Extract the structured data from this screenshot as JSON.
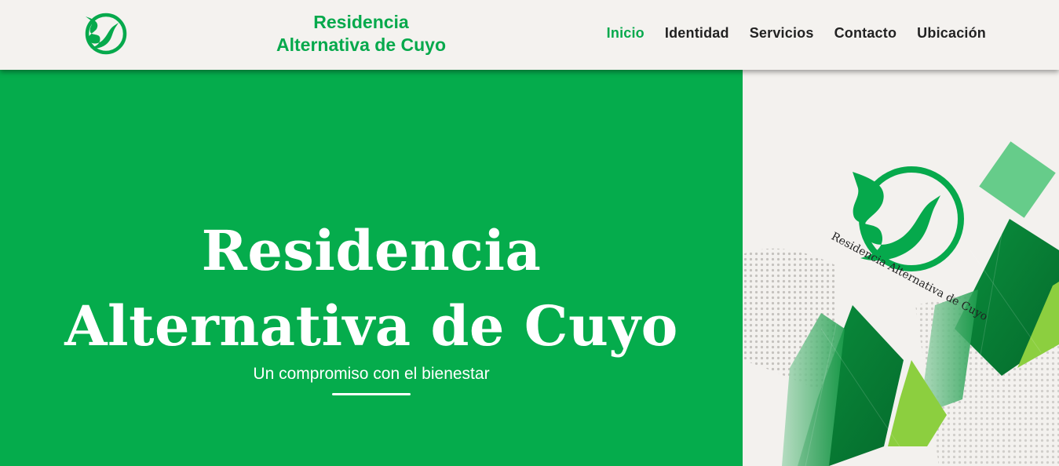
{
  "header": {
    "brand_line1": "Residencia",
    "brand_line2": "Alternativa de Cuyo",
    "logo_icon": "bird-circle-logo-icon"
  },
  "nav": {
    "items": [
      {
        "label": "Inicio",
        "active": true
      },
      {
        "label": "Identidad",
        "active": false
      },
      {
        "label": "Servicios",
        "active": false
      },
      {
        "label": "Contacto",
        "active": false
      },
      {
        "label": "Ubicación",
        "active": false
      }
    ]
  },
  "hero": {
    "title_line1": "Residencia",
    "title_line2": "Alternativa de Cuyo",
    "subtitle": "Un compromiso con el bienestar"
  },
  "art": {
    "emblem_text": "Residencia Alternativa de Cuyo"
  },
  "colors": {
    "brand_green": "#06a94c",
    "hero_green": "#05ac4c",
    "light_green": "#8ccf3f",
    "header_bg": "#f4f2ef",
    "nav_text": "#222222"
  }
}
